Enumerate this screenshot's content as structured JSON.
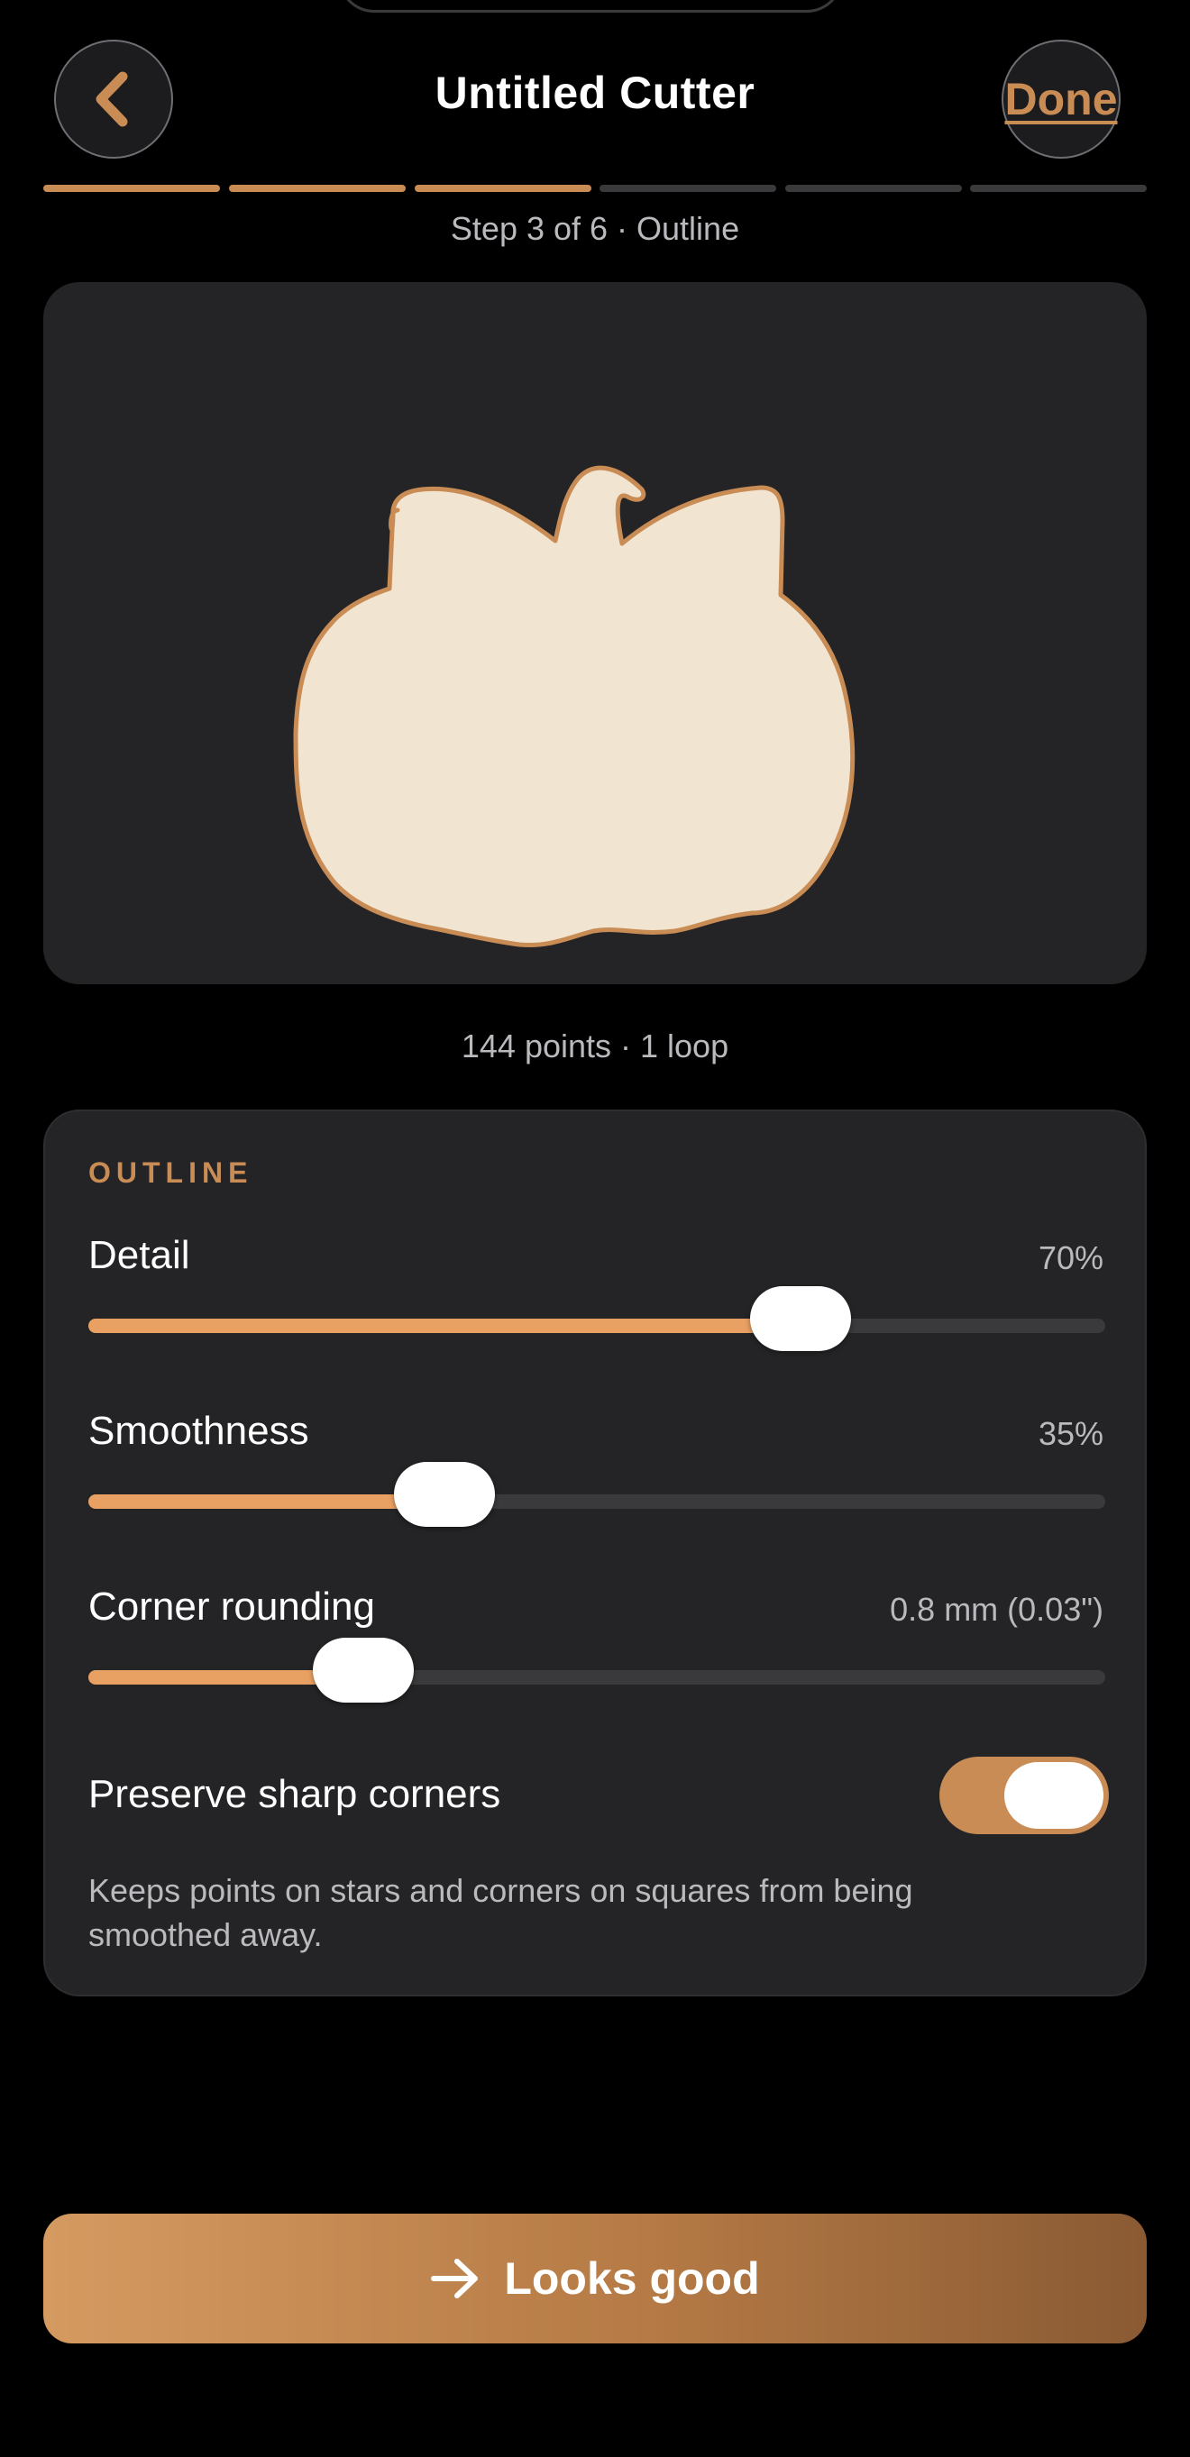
{
  "header": {
    "title": "Untitled Cutter",
    "done_label": "Done",
    "back_icon": "chevron-left-icon"
  },
  "progress": {
    "step_label": "Step 3 of 6 · Outline",
    "current_step": 3,
    "total_steps": 6
  },
  "preview": {
    "shape": "pumpkin",
    "stats": "144 points · 1 loop"
  },
  "outline": {
    "section_title": "OUTLINE",
    "detail": {
      "label": "Detail",
      "value_text": "70%",
      "value": 0.7
    },
    "smoothness": {
      "label": "Smoothness",
      "value_text": "35%",
      "value": 0.35
    },
    "corner_rounding": {
      "label": "Corner rounding",
      "value_text": "0.8 mm (0.03\")",
      "value": 0.27
    },
    "preserve_sharp_corners": {
      "label": "Preserve sharp corners",
      "enabled": true,
      "help": "Keeps points on stars and corners on squares from being smoothed away."
    }
  },
  "cta": {
    "label": "Looks good",
    "icon": "arrow-right-icon"
  },
  "colors": {
    "accent": "#c98c55",
    "slider_fill": "#e9a063",
    "card_bg": "#242426",
    "shape_fill": "#f1e5d1",
    "shape_stroke": "#c98c55"
  }
}
